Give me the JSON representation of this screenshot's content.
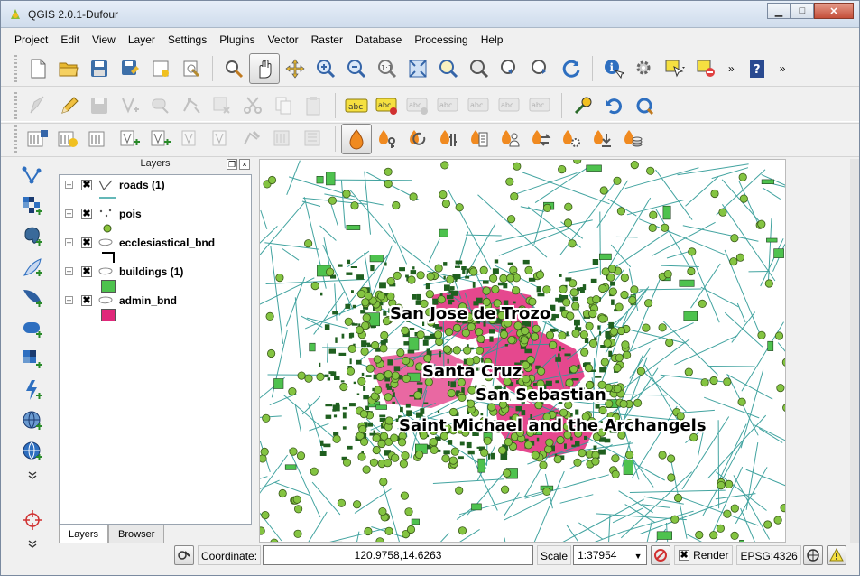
{
  "window": {
    "title": "QGIS 2.0.1-Dufour",
    "min_label": "▁",
    "max_label": "□",
    "close_label": "✕"
  },
  "menu": [
    "Project",
    "Edit",
    "View",
    "Layer",
    "Settings",
    "Plugins",
    "Vector",
    "Raster",
    "Database",
    "Processing",
    "Help"
  ],
  "toolbar1": {
    "icons": [
      "new-project-icon",
      "open-project-icon",
      "save-project-icon",
      "save-as-icon",
      "new-print-composer-icon",
      "composer-manager-icon",
      "touch-zoom-icon",
      "pan-icon",
      "pan-to-selection-icon",
      "zoom-in-icon",
      "zoom-out-icon",
      "zoom-actual-icon",
      "zoom-full-icon",
      "zoom-to-selection-icon",
      "zoom-to-layer-icon",
      "zoom-last-icon",
      "zoom-next-icon",
      "refresh-icon",
      "identify-icon",
      "run-feature-action-icon",
      "select-features-icon",
      "deselect-icon",
      "help-icon"
    ],
    "overflow_label": "»"
  },
  "toolbar2": {
    "icons": [
      "current-edits-icon",
      "toggle-editing-icon",
      "save-layer-edits-icon",
      "add-feature-icon",
      "move-feature-icon",
      "node-tool-icon",
      "delete-selected-icon",
      "cut-features-icon",
      "copy-features-icon",
      "paste-features-icon",
      "label-tool-icon",
      "pin-labels-icon",
      "show-hide-labels-icon",
      "move-label-icon",
      "rotate-label-icon",
      "change-label-icon",
      "python-console-icon",
      "undo-icon",
      "redo-icon"
    ]
  },
  "toolbar3": {
    "icons": [
      "raster-tool-1-icon",
      "raster-tool-2-icon",
      "raster-tool-3-icon",
      "vector-tool-1-icon",
      "vector-tool-2-icon",
      "vector-tool-3-icon",
      "vector-tool-4-icon",
      "vector-tool-5-icon",
      "vector-tool-6-icon",
      "vector-tool-7-icon",
      "osm-icon",
      "osm-key-icon",
      "osm-sync-icon",
      "osm-settings-icon",
      "osm-list-icon",
      "osm-user-icon",
      "osm-swap-icon",
      "osm-gear-icon",
      "osm-download-icon",
      "osm-stack-icon"
    ]
  },
  "left_toolbar": [
    "add-vector-layer-icon",
    "add-raster-layer-icon",
    "add-postgis-layer-icon",
    "add-spatialite-layer-icon",
    "add-mssql-layer-icon",
    "add-oracle-layer-icon",
    "add-wms-layer-icon",
    "add-wcs-layer-icon",
    "add-wfs-layer-icon",
    "new-shapefile-icon",
    "more-icon",
    "gps-tool-icon"
  ],
  "layers_panel": {
    "title": "Layers",
    "layers": [
      {
        "name": "roads (1)",
        "type": "line",
        "checked": "✖",
        "expand": "–",
        "color": "#30a0a0"
      },
      {
        "name": "pois",
        "type": "point",
        "checked": "✖",
        "expand": "–",
        "color": "#8bc43a"
      },
      {
        "name": "ecclesiastical_bnd",
        "type": "polygon",
        "checked": "✖",
        "expand": "–",
        "color": "#000000"
      },
      {
        "name": "buildings (1)",
        "type": "polygon",
        "checked": "✖",
        "expand": "–",
        "color": "#4ec24e"
      },
      {
        "name": "admin_bnd",
        "type": "polygon",
        "checked": "✖",
        "expand": "–",
        "color": "#e0287a"
      }
    ],
    "tabs": [
      "Layers",
      "Browser"
    ]
  },
  "map": {
    "labels": [
      "San Jose de Trozo",
      "Santa Cruz",
      "San Sebastian",
      "Saint Michael and the Archangels"
    ],
    "colors": {
      "roads": "#2e9a96",
      "pois": "#84c441",
      "buildings": "#1f5f1f",
      "admin": "#e0287a"
    }
  },
  "status": {
    "coordinate_label": "Coordinate:",
    "coordinate_value": "120.9758,14.6263",
    "scale_label": "Scale",
    "scale_value": "1:37954",
    "render_label": "Render",
    "render_checked": "✖",
    "crs": "EPSG:4326"
  }
}
